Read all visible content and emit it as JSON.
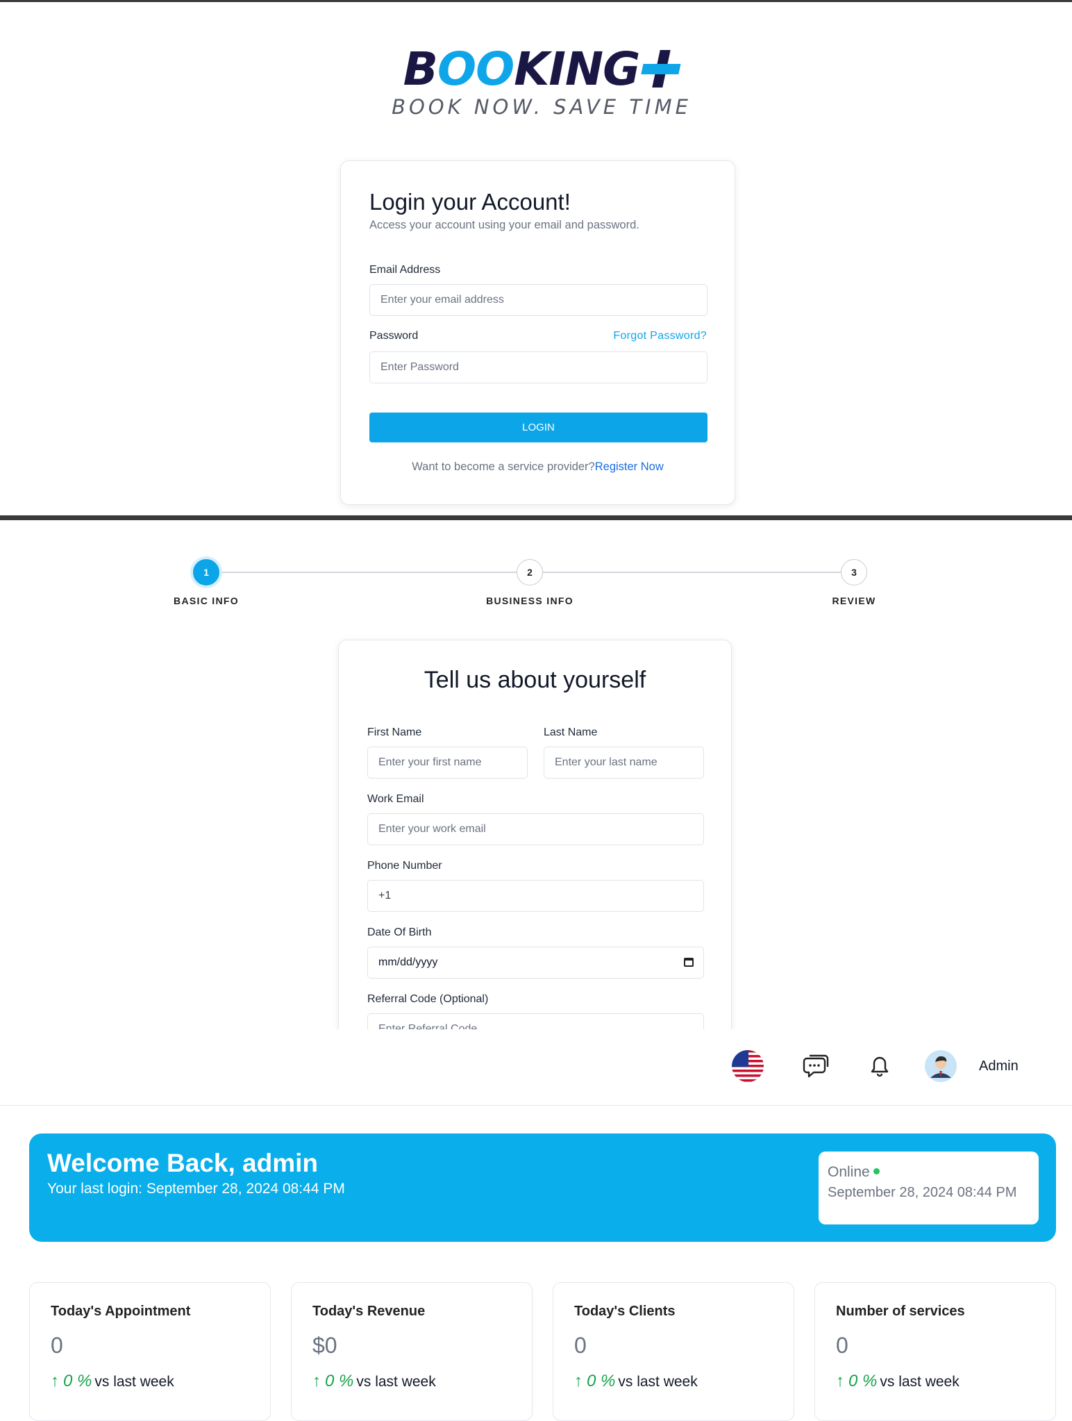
{
  "brand": {
    "logo_part1": "B",
    "logo_part2": "OO",
    "logo_part3": "KING",
    "tagline": "BOOK NOW. SAVE TIME"
  },
  "login": {
    "title": "Login your Account!",
    "subtitle": "Access your account using your email and password.",
    "email_label": "Email Address",
    "email_placeholder": "Enter your email address",
    "password_label": "Password",
    "forgot_link": "Forgot Password?",
    "password_placeholder": "Enter Password",
    "login_button": "LOGIN",
    "register_prompt": "Want to become a service provider?",
    "register_link": "Register Now"
  },
  "register": {
    "steps": [
      {
        "number": "1",
        "label": "BASIC INFO",
        "active": true
      },
      {
        "number": "2",
        "label": "BUSINESS INFO",
        "active": false
      },
      {
        "number": "3",
        "label": "REVIEW",
        "active": false
      }
    ],
    "title": "Tell us about yourself",
    "first_name_label": "First Name",
    "first_name_placeholder": "Enter your first name",
    "last_name_label": "Last Name",
    "last_name_placeholder": "Enter your last name",
    "work_email_label": "Work Email",
    "work_email_placeholder": "Enter your work email",
    "phone_label": "Phone Number",
    "phone_value": "+1",
    "dob_label": "Date Of Birth",
    "dob_placeholder": "mm/dd/yyyy",
    "referral_label": "Referral Code (Optional)",
    "referral_placeholder": "Enter Referral Code"
  },
  "dashboard": {
    "user_name": "Admin",
    "welcome_title": "Welcome Back, admin",
    "last_login": "Your last login: September 28, 2024 08:44 PM",
    "status_label": "Online",
    "status_time": "September 28, 2024 08:44 PM",
    "stats": [
      {
        "title": "Today's Appointment",
        "value": "0",
        "change": "0 %",
        "suffix": "vs last week"
      },
      {
        "title": "Today's Revenue",
        "value": "$0",
        "change": "0 %",
        "suffix": "vs last week"
      },
      {
        "title": "Today's Clients",
        "value": "0",
        "change": "0 %",
        "suffix": "vs last week"
      },
      {
        "title": "Number of services",
        "value": "0",
        "change": "0 %",
        "suffix": "vs last week"
      }
    ],
    "colors": {
      "accent": "#09aeea",
      "online": "#22c55e",
      "trend_up": "#16a34a"
    }
  }
}
